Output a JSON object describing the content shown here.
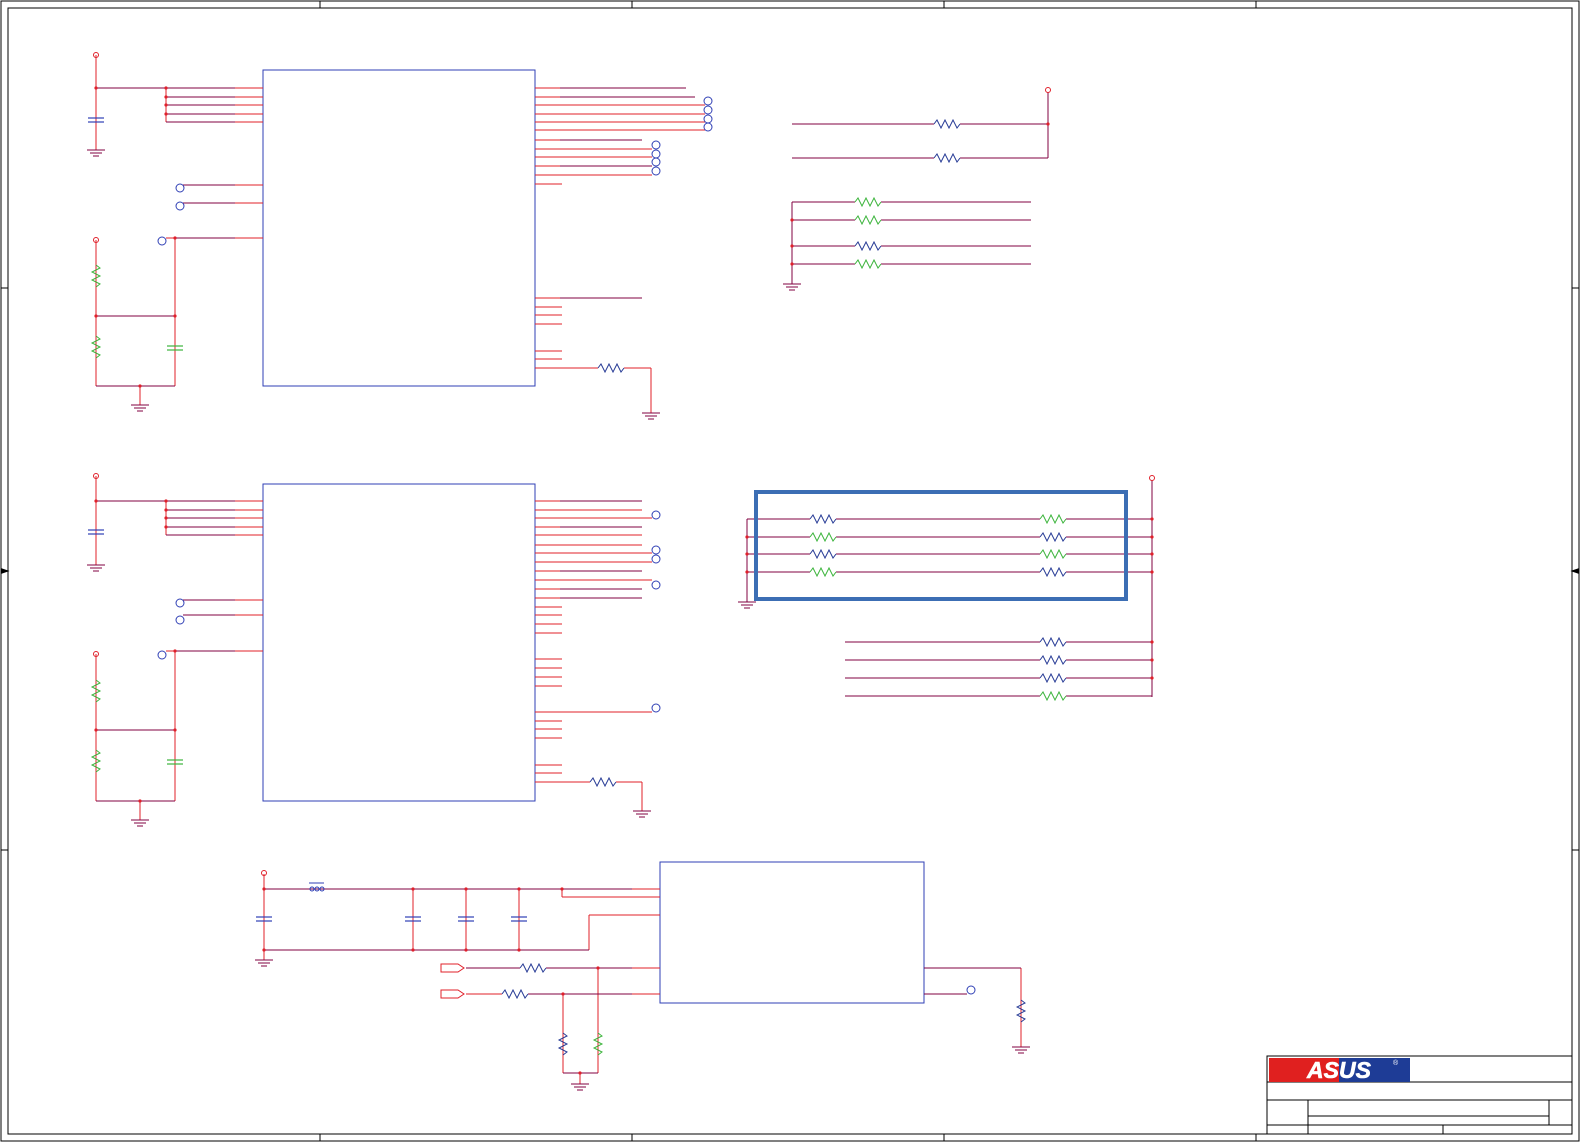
{
  "title_block": {
    "logo_text": "ASUS",
    "registered_mark": "®",
    "logo_colors": [
      "#e0201f",
      "#1e3c96"
    ]
  },
  "colors": {
    "frame": "#000000",
    "wire_red": "#e0202a",
    "wire_dark": "#800040",
    "ic_border": "#2f3fb5",
    "resistor_blue": "#283c96",
    "resistor_green": "#3cb43c",
    "highlight_box": "#3c6eb4"
  }
}
